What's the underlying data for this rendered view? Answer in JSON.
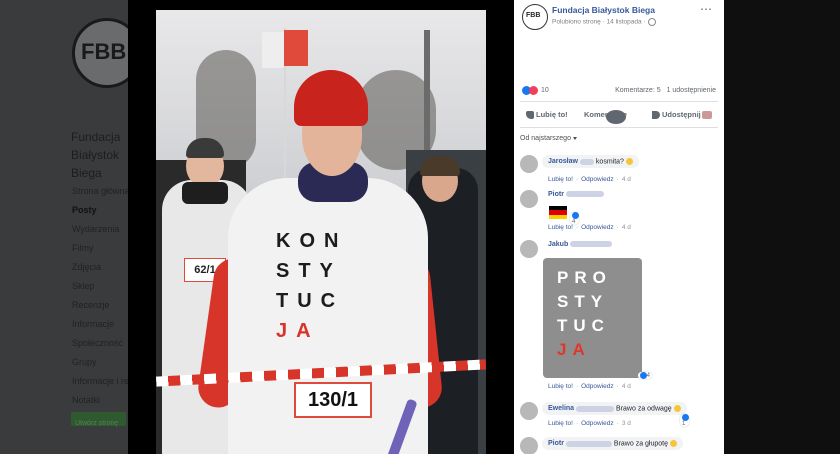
{
  "background_page": {
    "logo_text": "FBB",
    "page_name": "Fundacja Białystok Biega",
    "nav_items": [
      "Strona główna",
      "Posty",
      "Wydarzenia",
      "Filmy",
      "Zdjęcia",
      "Sklep",
      "Recenzje",
      "Informacje",
      "Społeczność",
      "Grupy",
      "Informacje i reklamy",
      "Notatki"
    ],
    "active_nav": "Posty",
    "button_label": "Utwórz stronę"
  },
  "photo": {
    "shirt_lines": [
      "KON",
      "STY",
      "TUC",
      "JA"
    ],
    "bib_main": "130/1",
    "bib_secondary": "62/1"
  },
  "post": {
    "page_name": "Fundacja Białystok Biega",
    "avatar_text": "FBB",
    "meta": "Polubiono stronę · 14 listopada ·",
    "more_icon": "⋯",
    "reactions_count": "10",
    "comments_count": "Komentarze: 5",
    "shares_count": "1 udostępnienie",
    "actions": {
      "like": "Lubię to!",
      "comment": "Komentarze",
      "share": "Udostępnij"
    },
    "sort_label": "Od najstarszego",
    "colors": {
      "link": "#385898",
      "like_blue": "#1877f2",
      "love_red": "#f33e58"
    }
  },
  "comments": [
    {
      "author": "Jarosław",
      "text": "kosmita?",
      "like": "Lubię to!",
      "reply": "Odpowiedz",
      "time": "4 d"
    },
    {
      "author": "Piotr",
      "text": "",
      "reactions": "4",
      "like": "Lubię to!",
      "reply": "Odpowiedz",
      "time": "4 d"
    },
    {
      "author": "Jakub",
      "text": "",
      "sticker_lines": [
        "PRO",
        "STY",
        "TUC",
        "JA"
      ],
      "reactions": "4",
      "like": "Lubię to!",
      "reply": "Odpowiedz",
      "time": "4 d"
    },
    {
      "author": "Ewelina",
      "text": "Brawo za odwagę",
      "reactions": "1",
      "like": "Lubię to!",
      "reply": "Odpowiedz",
      "time": "3 d"
    },
    {
      "author": "Piotr",
      "text": "Brawo za głupotę",
      "like": "",
      "reply": "",
      "time": ""
    }
  ]
}
